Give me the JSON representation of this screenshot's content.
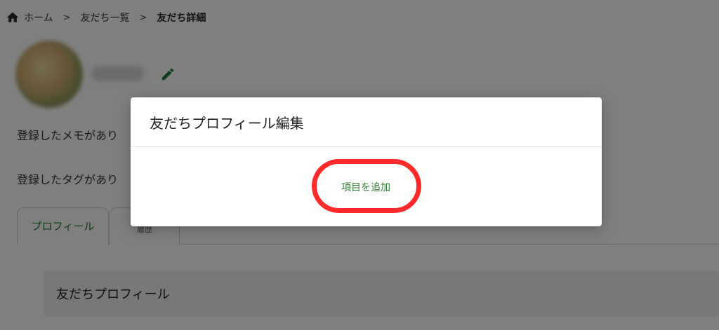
{
  "breadcrumb": {
    "home": "ホーム",
    "friends_list": "友だち一覧",
    "current": "友だち詳細",
    "separator": ">"
  },
  "profile": {
    "memo_text": "登録したメモがあり",
    "tag_text": "登録したタグがあり"
  },
  "tabs": {
    "profile": "プロフィール",
    "history": "履歴"
  },
  "panel": {
    "title": "友だちプロフィール"
  },
  "modal": {
    "title": "友だちプロフィール編集",
    "add_item_label": "項目を追加"
  },
  "colors": {
    "accent_green": "#2e7d32",
    "highlight_red": "#ff2b2b",
    "overlay": "rgba(0,0,0,0.5)"
  },
  "icons": {
    "home": "home-icon",
    "edit": "pencil-icon"
  }
}
